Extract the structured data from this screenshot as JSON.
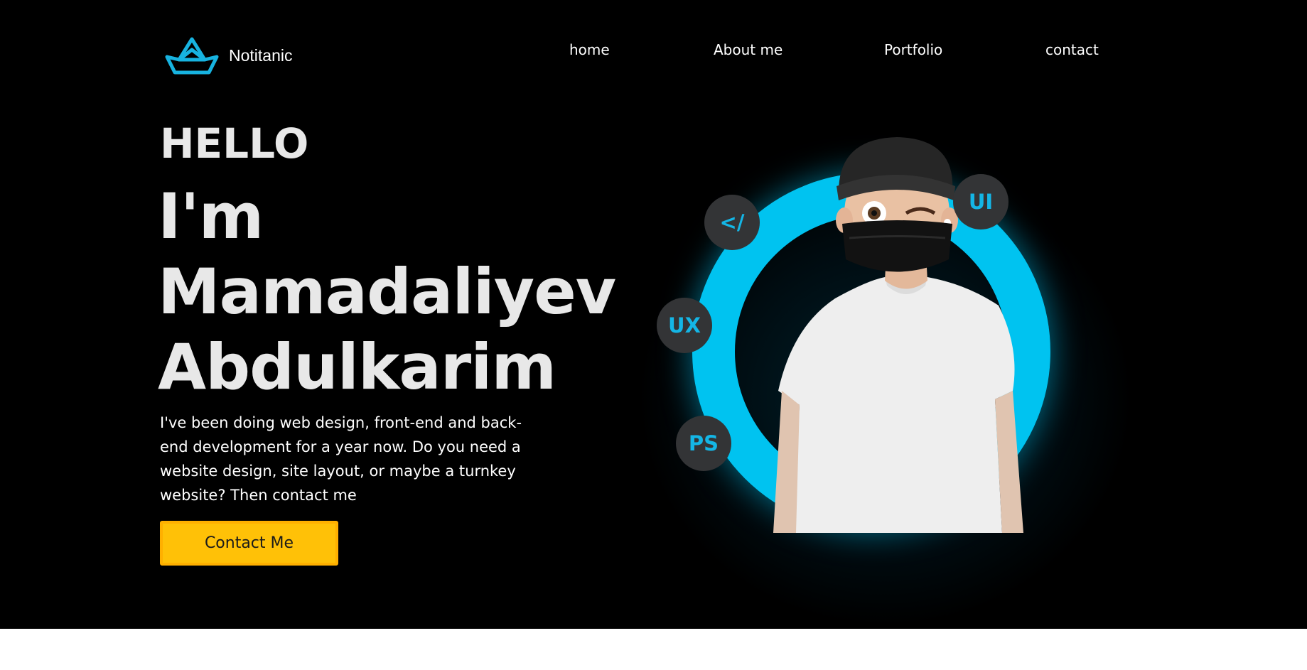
{
  "header": {
    "brand": "Notitanic",
    "nav": [
      "home",
      "About me",
      "Portfolio",
      "contact"
    ]
  },
  "hero": {
    "greeting": "HELLO",
    "name_lines": [
      "I'm",
      "Mamadaliyev",
      "Abdulkarim"
    ],
    "description": "I've been doing web design, front-end and back-end development for a year now. Do you need a website design, site layout, or maybe a turnkey website? Then contact me",
    "cta_label": "Contact Me"
  },
  "skills": [
    "</",
    "UI",
    "UX",
    "PS"
  ],
  "colors": {
    "background": "#000000",
    "accent": "#00c3f0",
    "button": "#ffc107",
    "badge_bg": "#333436"
  },
  "icons": {
    "logo": "paper-boat-icon"
  }
}
